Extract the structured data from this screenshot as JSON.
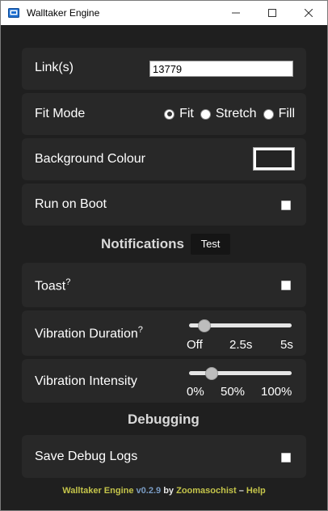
{
  "window": {
    "title": "Walltaker Engine"
  },
  "link": {
    "label": "Link(s)",
    "value": "13779"
  },
  "fit_mode": {
    "label": "Fit Mode",
    "options": [
      "Fit",
      "Stretch",
      "Fill"
    ],
    "selected": "Fit"
  },
  "background": {
    "label": "Background Colour",
    "color": "#242424"
  },
  "boot": {
    "label": "Run on Boot",
    "checked": false
  },
  "notifications": {
    "heading": "Notifications",
    "test_label": "Test",
    "toast": {
      "label": "Toast",
      "help": "?",
      "checked": false
    },
    "vibration_duration": {
      "label": "Vibration Duration",
      "help": "?",
      "ticks": [
        "Off",
        "2.5s",
        "5s"
      ],
      "value_fraction": 0.1
    },
    "vibration_intensity": {
      "label": "Vibration Intensity",
      "ticks": [
        "0%",
        "50%",
        "100%"
      ],
      "value_fraction": 0.18
    }
  },
  "debugging": {
    "heading": "Debugging",
    "save_logs": {
      "label": "Save Debug Logs",
      "checked": false
    }
  },
  "footer": {
    "app_name": "Walltaker Engine",
    "version": "v0.2.9",
    "by": "by",
    "author": "Zoomasochist",
    "sep": "–",
    "help": "Help"
  },
  "colors": {
    "background": "#1f1f1f",
    "card": "#282828",
    "footer_yellow": "#c4c44a",
    "footer_blue": "#7a9cc4"
  }
}
